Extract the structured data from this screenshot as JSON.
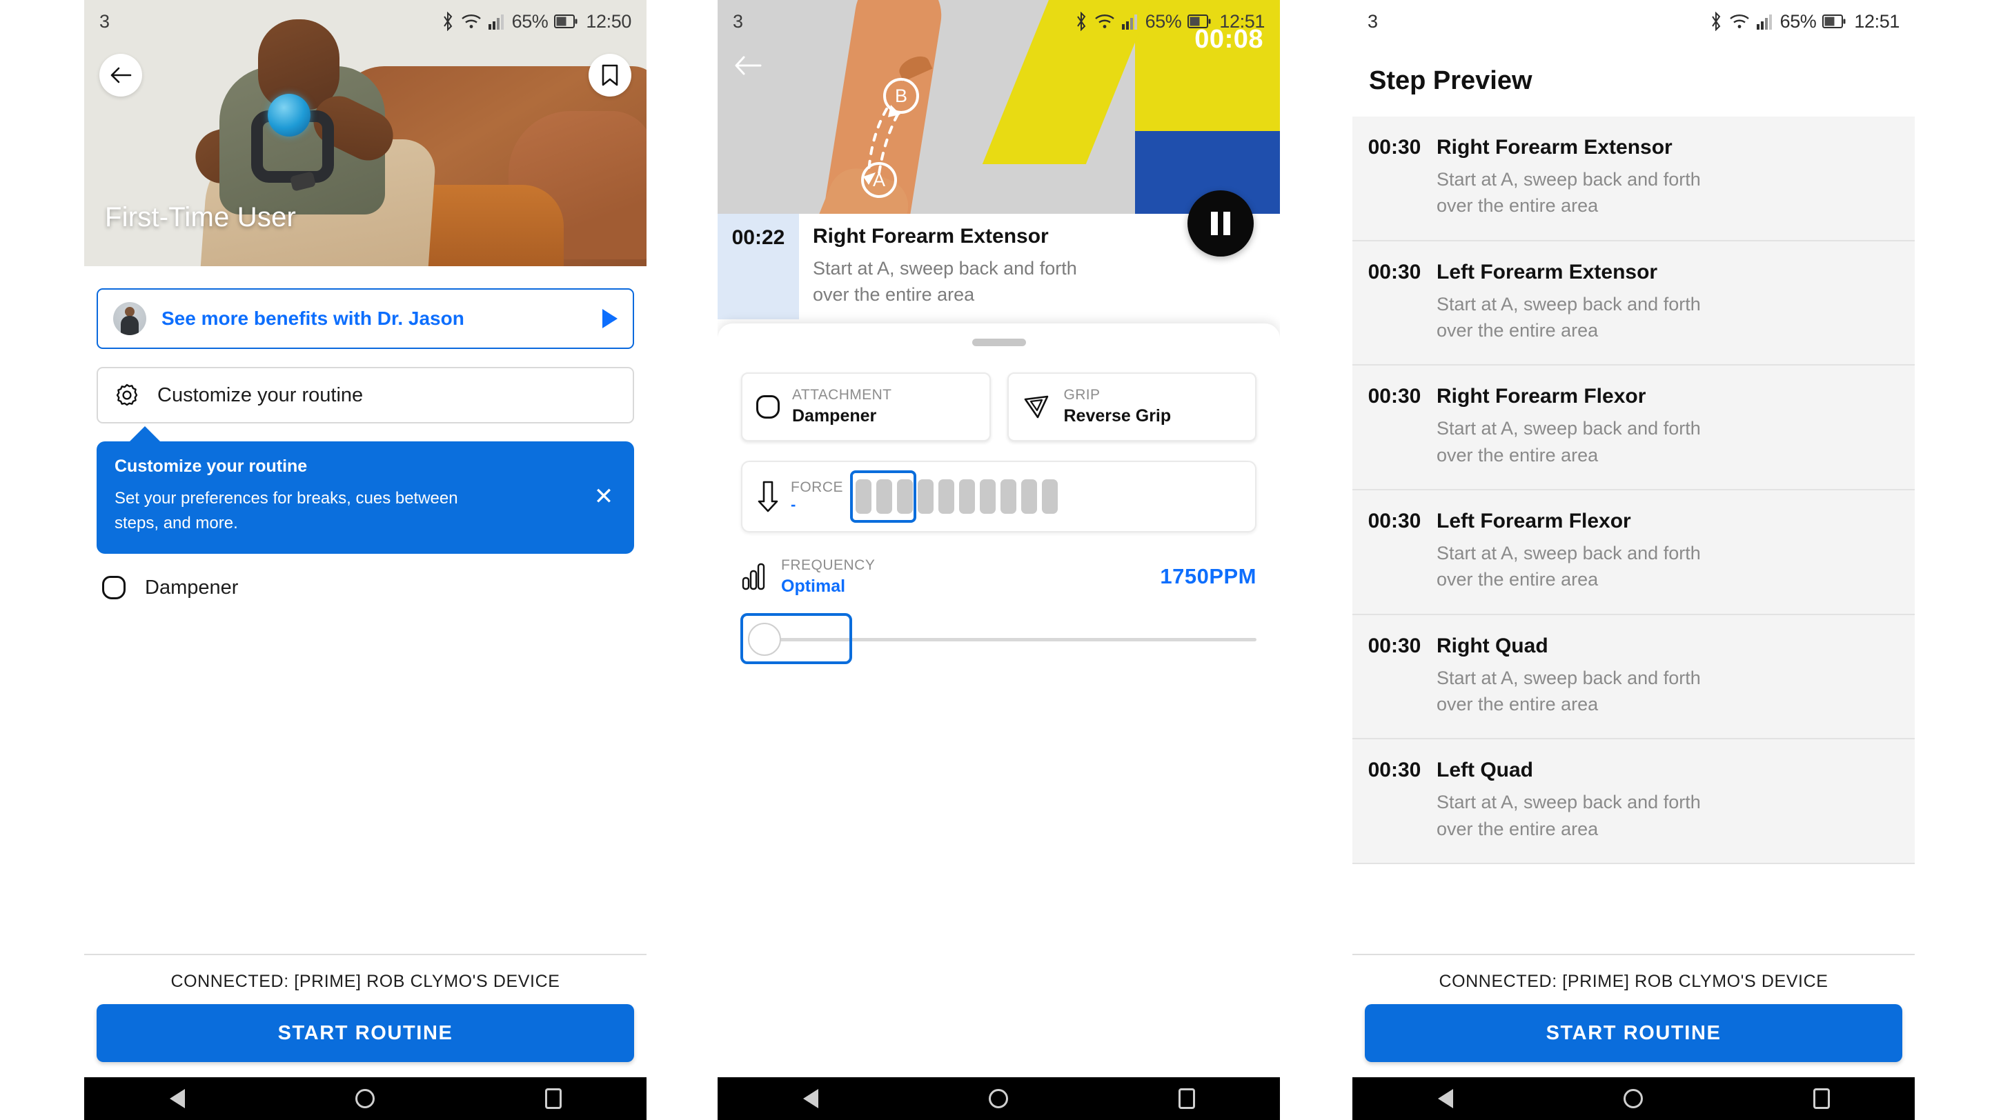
{
  "status_bar": {
    "notification_count": "3",
    "battery_pct": "65%",
    "time_1": "12:50",
    "time_2": "12:51",
    "time_3": "12:51",
    "icons": [
      "bluetooth-icon",
      "wifi-icon",
      "signal-icon",
      "battery-icon"
    ]
  },
  "colors": {
    "accent_blue": "#0a6ddc",
    "link_blue": "#0d6efd",
    "tooltip_blue": "#0b6fdd",
    "highlight_row": "#dde8f7",
    "list_row": "#f4f4f4",
    "illustration_skin": "#df9360",
    "illustration_shirt": "#e8db13",
    "illustration_pants": "#1f4fad"
  },
  "panel1": {
    "hero_title": "First-Time User",
    "back_button": "back-arrow",
    "bookmark_button": "bookmark",
    "benefits_label": "See more benefits with Dr. Jason",
    "customize_label": "Customize your routine",
    "tooltip": {
      "title": "Customize your routine",
      "body": "Set your preferences for breaks, cues between steps, and more.",
      "close": "✕"
    },
    "behind_item": "Dampener",
    "connected": "CONNECTED: [PRIME] ROB CLYMO'S DEVICE",
    "start_button": "START ROUTINE"
  },
  "panel2": {
    "timer": "00:08",
    "marker_a": "A",
    "marker_b": "B",
    "current_step": {
      "time": "00:22",
      "title": "Right Forearm Extensor",
      "description": "Start at A, sweep back and forth over the entire area"
    },
    "attachment": {
      "label": "ATTACHMENT",
      "value": "Dampener"
    },
    "grip": {
      "label": "GRIP",
      "value": "Reverse Grip"
    },
    "force": {
      "label": "FORCE",
      "value": "-",
      "segments_total": 10,
      "segments_active": 3
    },
    "frequency": {
      "label": "FREQUENCY",
      "sub": "Optimal",
      "value": "1750PPM",
      "slider_pct": 0
    }
  },
  "panel3": {
    "title": "Step Preview",
    "steps": [
      {
        "time": "00:30",
        "title": "Right Forearm Extensor",
        "description": "Start at A, sweep back and forth over the entire area"
      },
      {
        "time": "00:30",
        "title": "Left Forearm Extensor",
        "description": "Start at A, sweep back and forth over the entire area"
      },
      {
        "time": "00:30",
        "title": "Right Forearm Flexor",
        "description": "Start at A, sweep back and forth over the entire area"
      },
      {
        "time": "00:30",
        "title": "Left Forearm Flexor",
        "description": "Start at A, sweep back and forth over the entire area"
      },
      {
        "time": "00:30",
        "title": "Right Quad",
        "description": "Start at A, sweep back and forth over the entire area"
      },
      {
        "time": "00:30",
        "title": "Left Quad",
        "description": "Start at A, sweep back and forth over the entire area"
      }
    ],
    "connected": "CONNECTED: [PRIME] ROB CLYMO'S DEVICE",
    "start_button": "START ROUTINE"
  },
  "navbar": {
    "back": "nav-back-triangle",
    "home": "nav-home-circle",
    "recent": "nav-recent-square"
  }
}
